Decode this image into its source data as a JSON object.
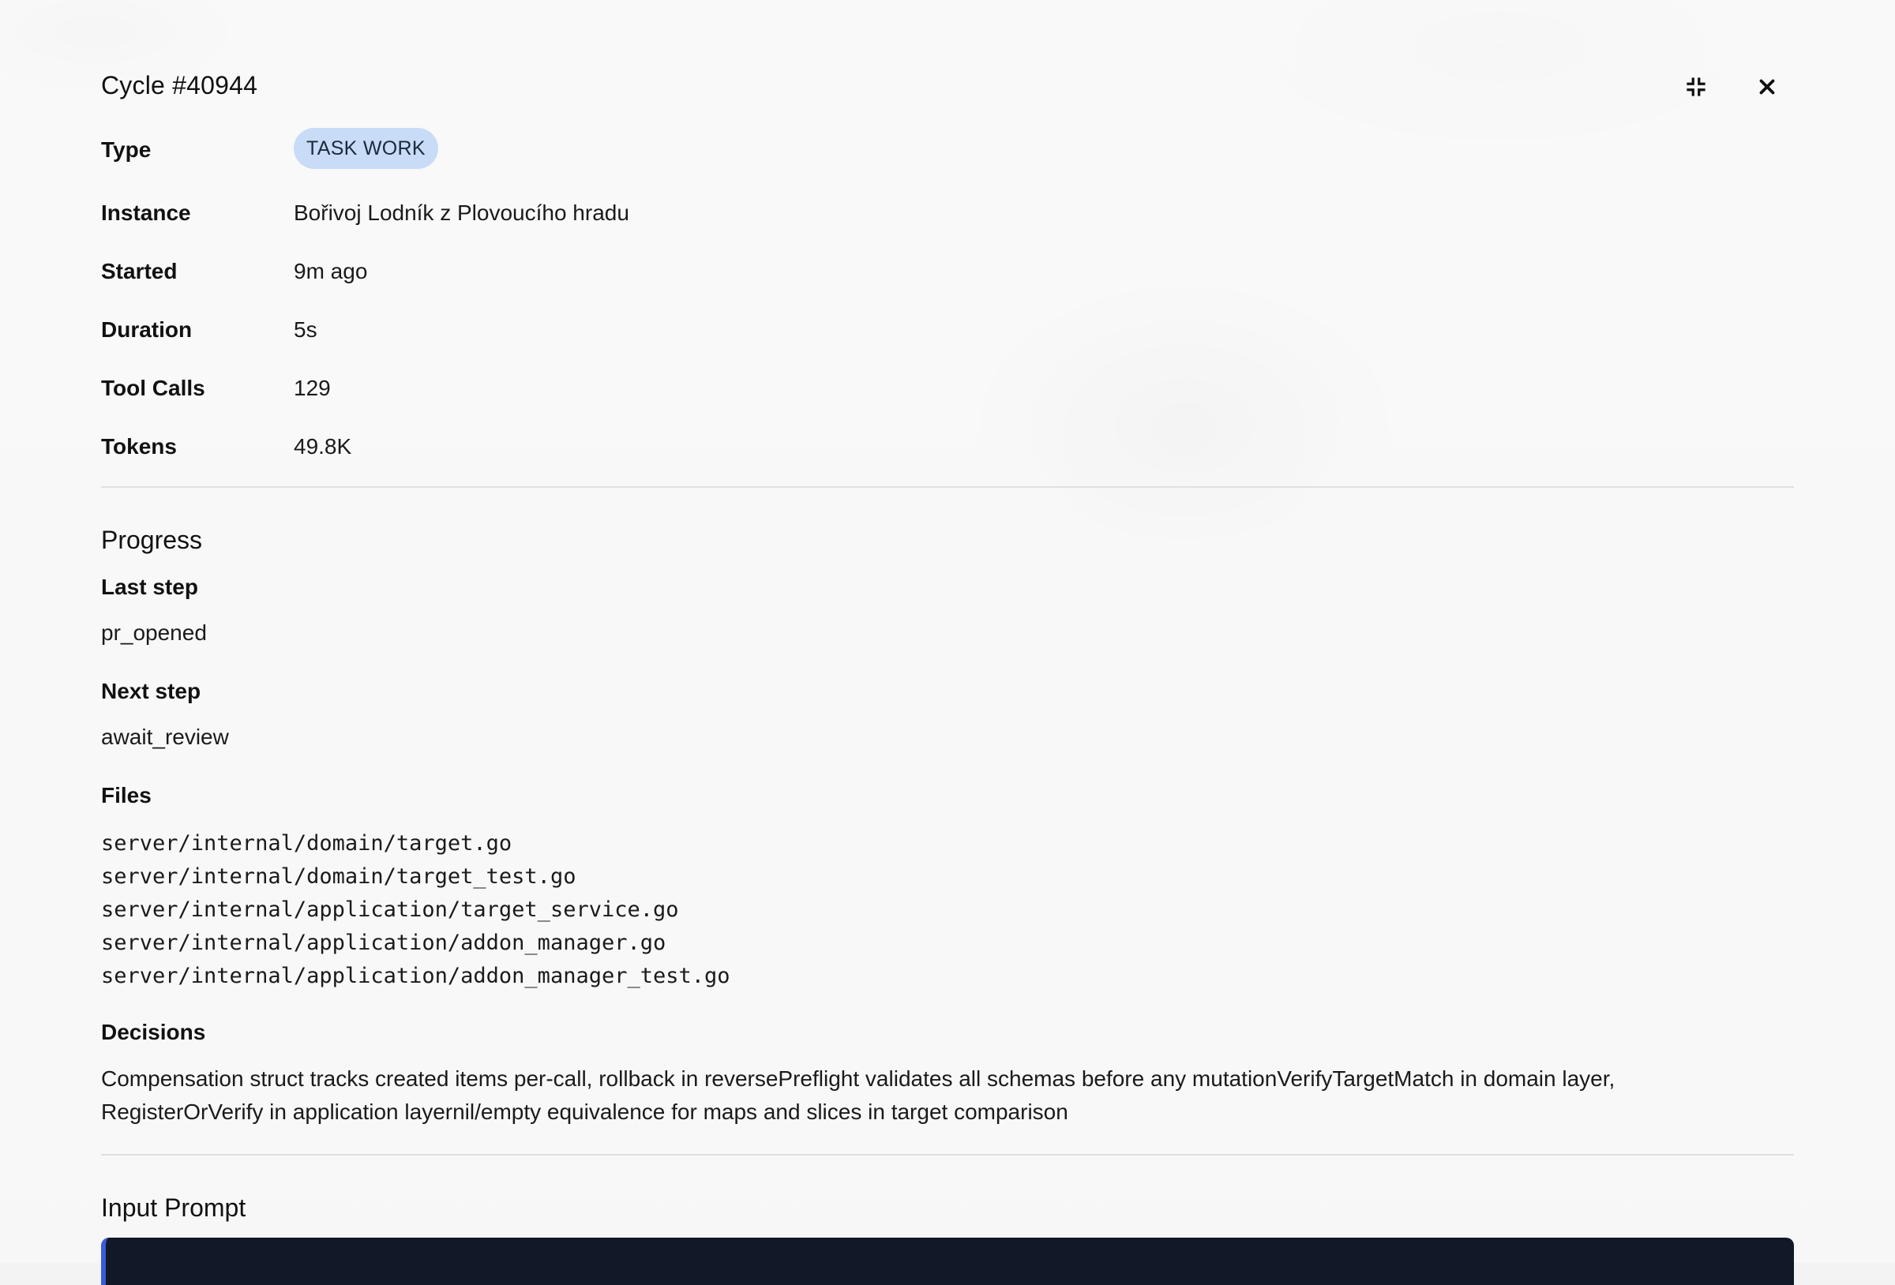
{
  "header": {
    "title": "Cycle #40944"
  },
  "props": {
    "type_label": "Type",
    "type_value": "TASK WORK",
    "instance_label": "Instance",
    "instance_value": "Bořivoj Lodník z Plovoucího hradu",
    "started_label": "Started",
    "started_value": "9m ago",
    "duration_label": "Duration",
    "duration_value": "5s",
    "tool_calls_label": "Tool Calls",
    "tool_calls_value": "129",
    "tokens_label": "Tokens",
    "tokens_value": "49.8K"
  },
  "progress": {
    "title": "Progress",
    "last_step_label": "Last step",
    "last_step_value": "pr_opened",
    "next_step_label": "Next step",
    "next_step_value": "await_review",
    "files_label": "Files",
    "files": [
      "server/internal/domain/target.go",
      "server/internal/domain/target_test.go",
      "server/internal/application/target_service.go",
      "server/internal/application/addon_manager.go",
      "server/internal/application/addon_manager_test.go"
    ],
    "decisions_label": "Decisions",
    "decisions_line1": "Compensation struct tracks created items per-call, rollback in reversePreflight validates all schemas before any mutationVerifyTargetMatch in domain layer,",
    "decisions_line2": "RegisterOrVerify in application layernil/empty equivalence for maps and slices in target comparison"
  },
  "input_prompt": {
    "title": "Input Prompt"
  },
  "icons": {
    "minimize": "collapse-arrows-icon",
    "close": "close-icon"
  },
  "colors": {
    "badge_bg": "#c8dcf7",
    "prompt_bg": "#111827",
    "prompt_accent": "#3b5bdb"
  }
}
